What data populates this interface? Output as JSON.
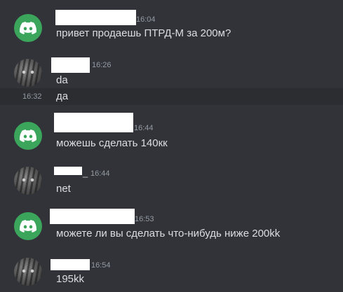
{
  "colors": {
    "background": "#313338",
    "hover_row": "#2b2d31",
    "discord_avatar": "#3ba55c",
    "timestamp": "#949ba4",
    "text": "#dbdee1"
  },
  "messages": [
    {
      "avatar": "discord-logo-icon",
      "timestamp": "16:04",
      "text": "привет продаешь ПТРД-М за 200м?"
    },
    {
      "avatar": "cat-avatar",
      "timestamp": "16:26",
      "text": "da"
    },
    {
      "avatar": null,
      "timestamp": "16:32",
      "text": "да"
    },
    {
      "avatar": "discord-logo-icon",
      "timestamp": "16:44",
      "text": "можешь сделать 140кк"
    },
    {
      "avatar": "cat-avatar",
      "timestamp": "16:44",
      "text": "net"
    },
    {
      "avatar": "discord-logo-icon",
      "timestamp": "16:53",
      "text": "можете ли вы сделать что-нибудь ниже 200kk"
    },
    {
      "avatar": "cat-avatar",
      "timestamp": "16:54",
      "text": "195kk"
    }
  ],
  "second_user_name_fragment": "_"
}
